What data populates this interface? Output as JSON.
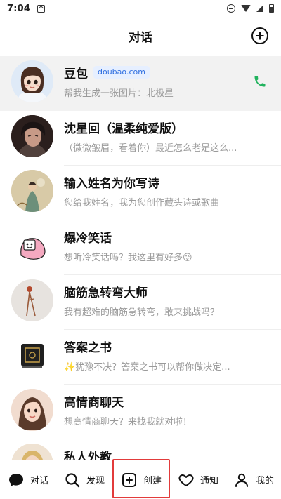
{
  "status_bar": {
    "time": "7:04",
    "icons": [
      "a-notification-icon",
      "do-not-disturb-icon",
      "wifi-icon",
      "signal-icon",
      "battery-icon"
    ]
  },
  "header": {
    "title": "对话",
    "add_icon": "plus-circle-icon"
  },
  "conversations": [
    {
      "name": "豆包",
      "tag": "doubao.com",
      "preview": "帮我生成一张图片：北极星",
      "action_icon": "phone-icon",
      "highlighted": true
    },
    {
      "name": "沈星回（温柔纯爱版）",
      "preview": "（微微皱眉，看着你）最近怎么老是这么..."
    },
    {
      "name": "输入姓名为你写诗",
      "preview": "您给我姓名，我为您创作藏头诗或歌曲"
    },
    {
      "name": "爆冷笑话",
      "preview": "想听冷笑话吗？我这里有好多😜"
    },
    {
      "name": "脑筋急转弯大师",
      "preview": "我有超难的脑筋急转弯，敢来挑战吗？"
    },
    {
      "name": "答案之书",
      "preview": "✨犹豫不决？答案之书可以帮你做决定..."
    },
    {
      "name": "高情商聊天",
      "preview": "想高情商聊天？来找我就对啦！"
    },
    {
      "name": "私人外教",
      "preview": ""
    }
  ],
  "bottom_nav": {
    "chat": "对话",
    "discover": "发现",
    "create": "创建",
    "notify": "通知",
    "me": "我的"
  },
  "colors": {
    "accent_blue": "#2f6fe0",
    "phone_green": "#22b35e",
    "highlight_red": "#e23b3b",
    "row_highlight": "#f2f2f2"
  }
}
